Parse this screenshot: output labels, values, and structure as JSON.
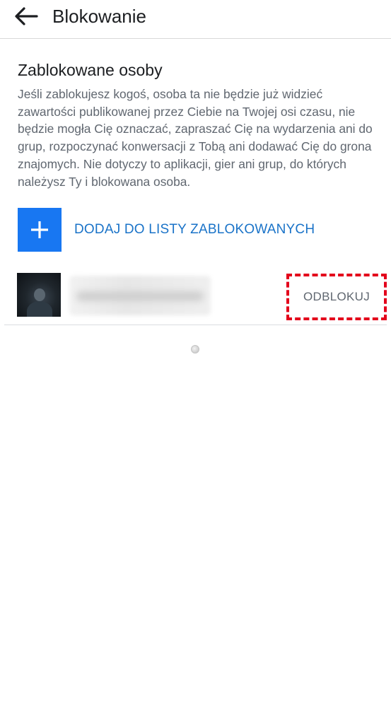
{
  "header": {
    "back_icon": "arrow-left-icon",
    "title": "Blokowanie"
  },
  "section": {
    "title": "Zablokowane osoby",
    "description": "Jeśli zablokujesz kogoś, osoba ta nie będzie już widzieć zawartości publikowanej przez Ciebie na Twojej osi czasu, nie będzie mogła Cię oznaczać, zapraszać Cię na wydarzenia ani do grup, rozpoczynać konwersacji z Tobą ani dodawać Cię do grona znajomych. Nie dotyczy to aplikacji, gier ani grup, do których należysz Ty i blokowana osoba."
  },
  "add_button": {
    "icon": "plus-icon",
    "label": "DODAJ DO LISTY ZABLOKOWANYCH"
  },
  "blocked_list": [
    {
      "avatar": "avatar",
      "name_hidden": true,
      "action_label": "ODBLOKUJ"
    }
  ],
  "loading_indicator": "spinner",
  "colors": {
    "accent": "#1877f2",
    "link_text": "#1a73c8",
    "highlight": "#e3001b",
    "secondary_text": "#606770"
  }
}
